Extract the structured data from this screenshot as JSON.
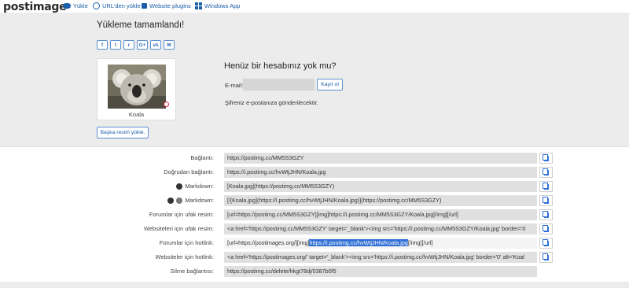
{
  "nav": {
    "logo": "postimage",
    "items": [
      {
        "label": "Yükle",
        "icon": "cloud-upload-icon"
      },
      {
        "label": "URL'den yükle",
        "icon": "globe-icon"
      },
      {
        "label": "Website plugins",
        "icon": "puzzle-icon"
      },
      {
        "label": "Windows App",
        "icon": "windows-icon"
      }
    ]
  },
  "upload": {
    "title": "Yükleme tamamlandı!",
    "share_buttons": [
      {
        "glyph": "f",
        "icon": "facebook-icon"
      },
      {
        "glyph": "t",
        "icon": "twitter-icon"
      },
      {
        "glyph": "r",
        "icon": "reddit-icon"
      },
      {
        "glyph": "G+",
        "icon": "google-plus-icon"
      },
      {
        "glyph": "vk",
        "icon": "vk-icon"
      },
      {
        "glyph": "✉",
        "icon": "email-icon"
      }
    ],
    "image_caption": "Koala",
    "upload_another": "Başka resim yükle."
  },
  "account": {
    "title": "Henüz bir hesabınız yok mu?",
    "email_label": "E-mail:",
    "email_value": "",
    "register_button": "Kayıt ol",
    "password_note": "Şifreniz e-postanıza gönderilecektir."
  },
  "links": [
    {
      "label": "Bağlantı:",
      "value": "https://postimg.cc/MM5S3GZY"
    },
    {
      "label": "Doğrudan bağlantı:",
      "value": "https://i.postimg.cc/hvWtjJHN/Koala.jpg"
    },
    {
      "label": "Markdown:",
      "icon": "reddit-icon",
      "value": "[Koala.jpg](https://postimg.cc/MM5S3GZY)"
    },
    {
      "label": "Markdown:",
      "icon": "github-icon",
      "value": "[![Koala.jpg](https://i.postimg.cc/hvWtjJHN/Koala.jpg)](https://postimg.cc/MM5S3GZY)"
    },
    {
      "label": "Forumlar için ufak resim:",
      "value": "[url=https://postimg.cc/MM5S3GZY][img]https://i.postimg.cc/MM5S3GZY/Koala.jpg[/img][/url]"
    },
    {
      "label": "Websiteleri için ufak resim:",
      "value": "<a href='https://postimg.cc/MM5S3GZY' target='_blank'><img src='https://i.postimg.cc/MM5S3GZY/Koala.jpg' border='0"
    },
    {
      "label": "Forumlar için hotlink:",
      "value_pre": "[url=https://postimages.org/][img]",
      "value_sel": "https://i.postimg.cc/hvWtjJHN/Koala.jpg",
      "value_post": "[/img][/url]"
    },
    {
      "label": "Websiteler için hotlink:",
      "value": "<a href='https://postimages.org/' target='_blank'><img src='https://i.postimg.cc/hvWtjJHN/Koala.jpg' border='0' alt='Koal"
    },
    {
      "label": "Silme bağlantısı:",
      "value": "https://postimg.cc/delete/hkgt78dj/0387b0f5"
    }
  ]
}
